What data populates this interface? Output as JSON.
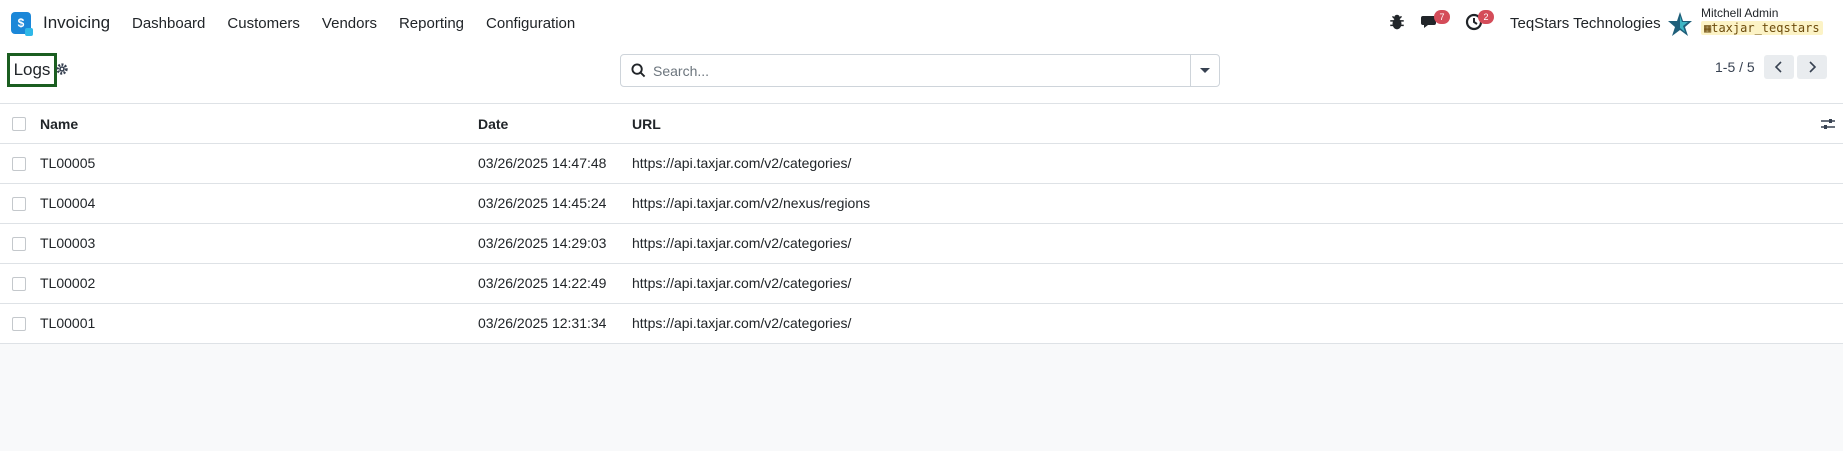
{
  "app": {
    "name": "Invoicing",
    "logo_glyph": "$"
  },
  "menu": [
    {
      "label": "Dashboard"
    },
    {
      "label": "Customers"
    },
    {
      "label": "Vendors"
    },
    {
      "label": "Reporting"
    },
    {
      "label": "Configuration"
    }
  ],
  "systray": {
    "debug_icon": "bug-icon",
    "messages_count": "7",
    "activities_count": "2",
    "company": "TeqStars Technologies",
    "user_name": "Mitchell Admin",
    "database": "taxjar_teqstars"
  },
  "page": {
    "title": "Logs"
  },
  "search": {
    "placeholder": "Search..."
  },
  "pager": {
    "value": "1-5 / 5"
  },
  "table": {
    "columns": {
      "name": "Name",
      "date": "Date",
      "url": "URL"
    },
    "rows": [
      {
        "name": "TL00005",
        "date": "03/26/2025 14:47:48",
        "url": "https://api.taxjar.com/v2/categories/"
      },
      {
        "name": "TL00004",
        "date": "03/26/2025 14:45:24",
        "url": "https://api.taxjar.com/v2/nexus/regions"
      },
      {
        "name": "TL00003",
        "date": "03/26/2025 14:29:03",
        "url": "https://api.taxjar.com/v2/categories/"
      },
      {
        "name": "TL00002",
        "date": "03/26/2025 14:22:49",
        "url": "https://api.taxjar.com/v2/categories/"
      },
      {
        "name": "TL00001",
        "date": "03/26/2025 12:31:34",
        "url": "https://api.taxjar.com/v2/categories/"
      }
    ]
  },
  "colors": {
    "accent": "#1b87d8",
    "badge": "#d44c59",
    "title_highlight": "#1b5e20"
  }
}
